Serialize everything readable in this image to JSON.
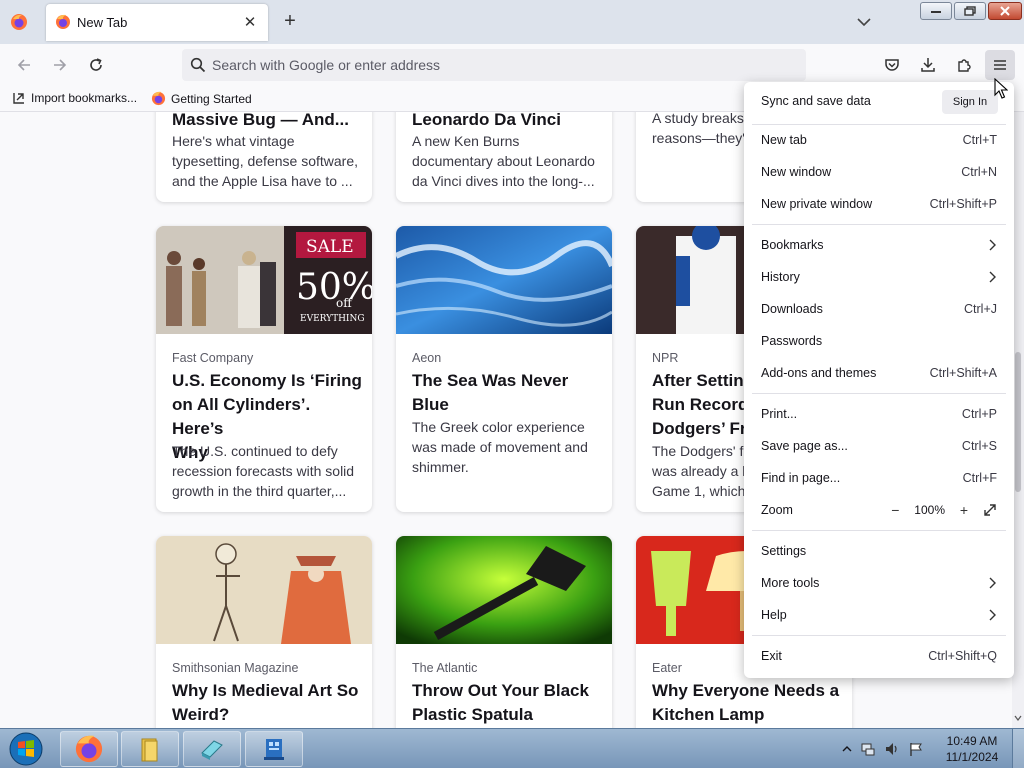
{
  "browser": {
    "tab": {
      "title": "New Tab",
      "close_glyph": "✕"
    },
    "newtab_glyph": "+",
    "urlbar": {
      "placeholder": "Search with Google or enter address"
    },
    "bookmarks": [
      {
        "label": "Import bookmarks...",
        "icon": "import-icon"
      },
      {
        "label": "Getting Started",
        "icon": "firefox-icon"
      }
    ]
  },
  "cards_top": [
    {
      "title": "Massive Bug — And...",
      "excerpt": [
        "Here's what vintage",
        "typesetting, defense software,",
        "and the Apple Lisa have to ..."
      ]
    },
    {
      "title": "Leonardo Da Vinci",
      "excerpt": [
        "A new Ken Burns",
        "documentary about Leonardo",
        "da Vinci dives into the long-..."
      ]
    },
    {
      "title": "",
      "excerpt": [
        "A study breaks",
        "reasons—they'"
      ]
    }
  ],
  "cards_mid": [
    {
      "source": "Fast Company",
      "title": [
        "U.S. Economy Is ‘Firing",
        "on All Cylinders’. Here’s",
        "Why"
      ],
      "excerpt": [
        "The U.S. continued to defy",
        "recession forecasts with solid",
        "growth in the third quarter,..."
      ],
      "sale_text": [
        "SALE",
        "50%",
        "off",
        "EVERYTHING"
      ]
    },
    {
      "source": "Aeon",
      "title": [
        "The Sea Was Never",
        "Blue"
      ],
      "excerpt": [
        "The Greek color experience",
        "was made of movement and",
        "shimmer."
      ]
    },
    {
      "source": "NPR",
      "title": [
        "After Setting",
        "Run Record,",
        "Dodgers’ Fre"
      ],
      "excerpt": [
        "The Dodgers' fr",
        "was already a h",
        "Game 1, which"
      ]
    }
  ],
  "cards_bottom": [
    {
      "source": "Smithsonian Magazine",
      "title": [
        "Why Is Medieval Art So",
        "Weird?"
      ]
    },
    {
      "source": "The Atlantic",
      "title": [
        "Throw Out Your Black",
        "Plastic Spatula"
      ]
    },
    {
      "source": "Eater",
      "title": [
        "Why Everyone Needs a",
        "Kitchen Lamp"
      ]
    }
  ],
  "app_menu": {
    "sync_label": "Sync and save data",
    "signin_label": "Sign In",
    "items": [
      {
        "label": "New tab",
        "shortcut": "Ctrl+T"
      },
      {
        "label": "New window",
        "shortcut": "Ctrl+N"
      },
      {
        "label": "New private window",
        "shortcut": "Ctrl+Shift+P"
      },
      {
        "label": "Bookmarks",
        "shortcut": ""
      },
      {
        "label": "History",
        "shortcut": ""
      },
      {
        "label": "Downloads",
        "shortcut": "Ctrl+J"
      },
      {
        "label": "Passwords",
        "shortcut": ""
      },
      {
        "label": "Add-ons and themes",
        "shortcut": "Ctrl+Shift+A"
      },
      {
        "label": "Print...",
        "shortcut": "Ctrl+P"
      },
      {
        "label": "Save page as...",
        "shortcut": "Ctrl+S"
      },
      {
        "label": "Find in page...",
        "shortcut": "Ctrl+F"
      },
      {
        "label": "Zoom",
        "shortcut": ""
      },
      {
        "label": "Settings",
        "shortcut": ""
      },
      {
        "label": "More tools",
        "shortcut": ""
      },
      {
        "label": "Help",
        "shortcut": ""
      },
      {
        "label": "Exit",
        "shortcut": "Ctrl+Shift+Q"
      }
    ],
    "zoom": {
      "minus": "−",
      "value": "100%",
      "plus": "+"
    }
  },
  "taskbar": {
    "time": "10:49 AM",
    "date": "11/1/2024",
    "apps": [
      "firefox-icon",
      "explorer-folder-icon",
      "app-icon",
      "network-app-icon"
    ]
  }
}
